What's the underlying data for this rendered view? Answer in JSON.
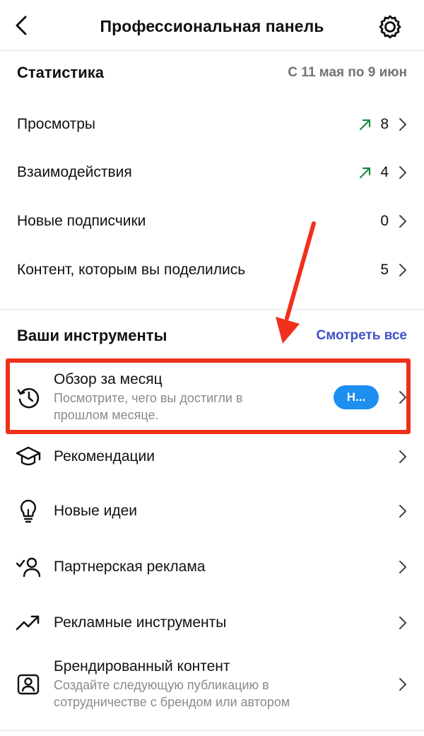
{
  "header": {
    "title": "Профессиональная панель",
    "back_icon": "chevron-left-icon",
    "settings_icon": "settings-gear-icon"
  },
  "stats": {
    "heading": "Статистика",
    "date_range": "С 11 мая по 9 июн",
    "items": [
      {
        "label": "Просмотры",
        "value": "8",
        "trend": "up"
      },
      {
        "label": "Взаимодействия",
        "value": "4",
        "trend": "up"
      },
      {
        "label": "Новые подписчики",
        "value": "0",
        "trend": ""
      },
      {
        "label": "Контент, которым вы поделились",
        "value": "5",
        "trend": ""
      }
    ]
  },
  "tools": {
    "heading": "Ваши инструменты",
    "see_all": "Смотреть все",
    "items": [
      {
        "title": "Обзор за месяц",
        "desc_line1": "Посмотрите, чего вы достигли в",
        "desc_line2": "прошлом месяце.",
        "badge": "Н...",
        "icon": "history-clock-icon"
      },
      {
        "title": "Рекомендации",
        "icon": "graduation-cap-icon"
      },
      {
        "title": "Новые идеи",
        "icon": "lightbulb-icon"
      },
      {
        "title": "Партнерская реклама",
        "icon": "partner-check-user-icon"
      },
      {
        "title": "Рекламные инструменты",
        "icon": "trend-chart-icon"
      },
      {
        "title": "Брендированный контент",
        "desc_line1": "Создайте следующую публикацию в",
        "desc_line2": "сотрудничестве с брендом или автором",
        "icon": "branded-content-icon"
      }
    ]
  },
  "colors": {
    "accent_link": "#4150c8",
    "badge_blue": "#1c8ff0",
    "trend_green": "#1f8a3a",
    "annotation_red": "#f0301c"
  }
}
